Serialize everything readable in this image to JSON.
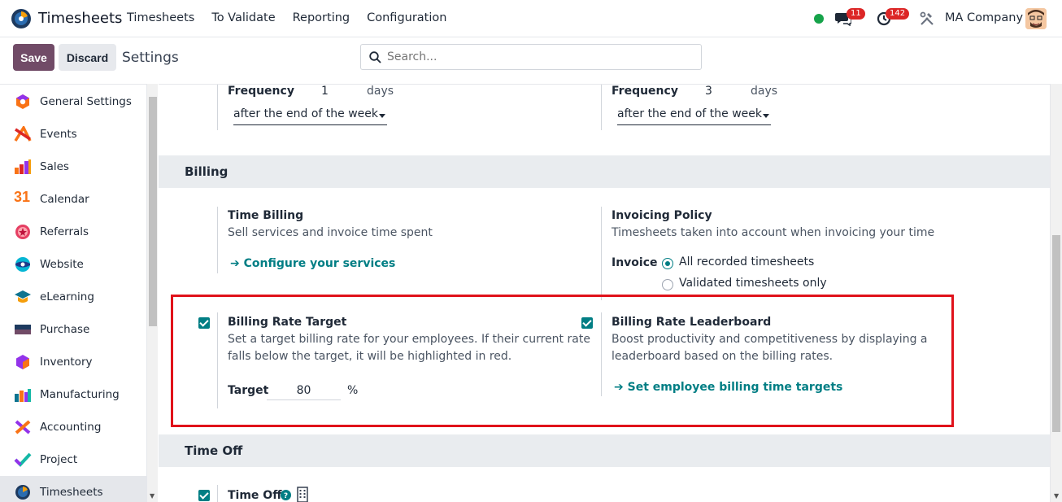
{
  "navbar": {
    "app_name": "Timesheets",
    "menu": [
      "Timesheets",
      "To Validate",
      "Reporting",
      "Configuration"
    ],
    "chat_badge": "11",
    "activity_badge": "142",
    "company": "MA Company"
  },
  "control": {
    "save_label": "Save",
    "discard_label": "Discard",
    "title": "Settings",
    "search_placeholder": "Search..."
  },
  "sidebar": {
    "items": [
      {
        "label": "General Settings",
        "icon": "settings-icon"
      },
      {
        "label": "Events",
        "icon": "events-icon"
      },
      {
        "label": "Sales",
        "icon": "sales-icon"
      },
      {
        "label": "Calendar",
        "icon": "calendar-icon"
      },
      {
        "label": "Referrals",
        "icon": "referrals-icon"
      },
      {
        "label": "Website",
        "icon": "website-icon"
      },
      {
        "label": "eLearning",
        "icon": "elearning-icon"
      },
      {
        "label": "Purchase",
        "icon": "purchase-icon"
      },
      {
        "label": "Inventory",
        "icon": "inventory-icon"
      },
      {
        "label": "Manufacturing",
        "icon": "manufacturing-icon"
      },
      {
        "label": "Accounting",
        "icon": "accounting-icon"
      },
      {
        "label": "Project",
        "icon": "project-icon"
      },
      {
        "label": "Timesheets",
        "icon": "timesheets-icon"
      }
    ],
    "calendar_number": "31"
  },
  "reminders": {
    "left": {
      "frequency_label": "Frequency",
      "frequency_value": "1",
      "unit": "days",
      "when": "after the end of the week"
    },
    "right": {
      "frequency_label": "Frequency",
      "frequency_value": "3",
      "unit": "days",
      "when": "after the end of the week"
    }
  },
  "billing": {
    "section_title": "Billing",
    "time_billing": {
      "title": "Time Billing",
      "desc": "Sell services and invoice time spent",
      "link": "Configure your services"
    },
    "invoicing_policy": {
      "title": "Invoicing Policy",
      "desc": "Timesheets taken into account when invoicing your time",
      "invoice_label": "Invoice",
      "options": [
        "All recorded timesheets",
        "Validated timesheets only"
      ]
    },
    "rate_target": {
      "title": "Billing Rate Target",
      "desc1": "Set a target billing rate for your employees. If their current rate",
      "desc2": "falls below the target, it will be highlighted in red.",
      "target_label": "Target",
      "target_value": "80",
      "unit": "%"
    },
    "leaderboard": {
      "title": "Billing Rate Leaderboard",
      "desc1": "Boost productivity and competitiveness by displaying a",
      "desc2": "leaderboard based on the billing rates.",
      "link": "Set employee billing time targets"
    }
  },
  "time_off": {
    "section_title": "Time Off",
    "item_label": "Time Off"
  },
  "colors": {
    "brand": "#714b67",
    "accent": "#017e84",
    "highlight": "#e0121a"
  }
}
